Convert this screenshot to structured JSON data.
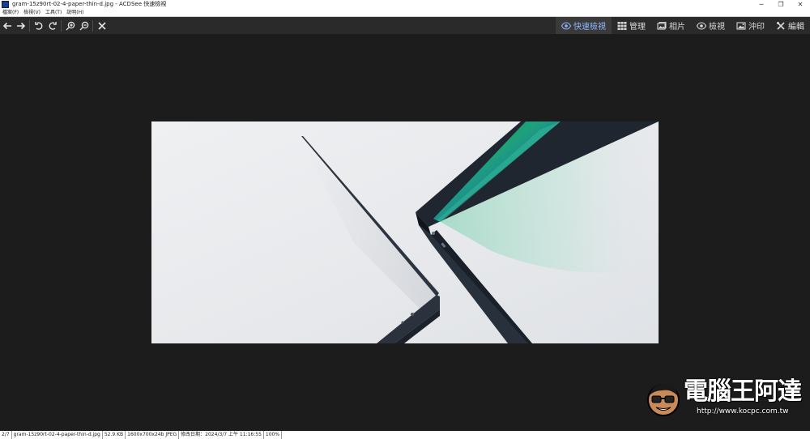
{
  "window": {
    "title": "gram-15z90rt-02-4-paper-thin-d.jpg - ACDSee 快速檢視",
    "controls": [
      "─",
      "❐",
      "✕"
    ]
  },
  "menu": [
    "檔案(F)",
    "檢視(V)",
    "工具(T)",
    "說明(H)"
  ],
  "toolbar": {
    "icons": [
      "arrow-left-icon",
      "arrow-right-icon",
      "rotate-left-icon",
      "rotate-right-icon",
      "zoom-in-icon",
      "zoom-out-icon",
      "close-icon"
    ]
  },
  "modes": [
    {
      "label": "快速檢視",
      "icon": "eye-icon",
      "active": true
    },
    {
      "label": "管理",
      "icon": "grid-icon",
      "active": false
    },
    {
      "label": "相片",
      "icon": "photos-icon",
      "active": false
    },
    {
      "label": "檢視",
      "icon": "eye-icon",
      "active": false
    },
    {
      "label": "沖印",
      "icon": "print-icon",
      "active": false
    },
    {
      "label": "編輯",
      "icon": "tools-icon",
      "active": false
    }
  ],
  "watermark": {
    "title": "電腦王阿達",
    "url": "http://www.kocpc.com.tw"
  },
  "status": {
    "index": "2/7",
    "filename": "gram-15z90rt-02-4-paper-thin-d.jpg",
    "filesize": "52.9 KB",
    "dimensions": "1600x700x24b JPEG",
    "modified": "修改日期：2024/3/7 上午 11:16:55",
    "zoom": "100%"
  },
  "colors": {
    "background": "#1c1c1c",
    "toolbar": "#2a2a2a",
    "accent": "#8fb6ff"
  }
}
